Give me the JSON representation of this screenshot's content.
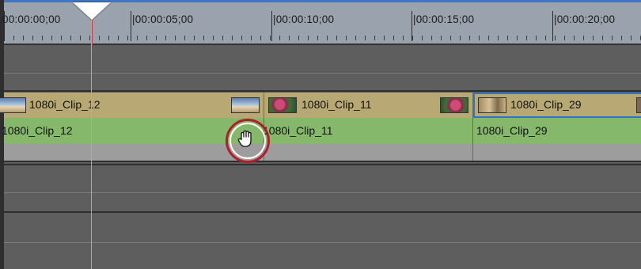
{
  "ruler": {
    "labels": [
      "00:00:00;00",
      "|00:00:05;00",
      "|00:00:10;00",
      "|00:00:15;00",
      "|00:00:20;00"
    ]
  },
  "clips": [
    {
      "name": "1080i_Clip_12",
      "title": "1080i_Clip_12",
      "audio_label": "1080i_Clip_12",
      "selected": false
    },
    {
      "name": "1080i_Clip_11",
      "title": "1080i_Clip_11",
      "audio_label": "1080i_Clip_11",
      "selected": false
    },
    {
      "name": "1080i_Clip_29",
      "title": "1080i_Clip_29",
      "audio_label": "1080i_Clip_29",
      "selected": true
    }
  ],
  "colors": {
    "ruler_bg": "#9aa3ad",
    "video_clip": "#b8a874",
    "audio_clip": "#86b86c",
    "selection": "#2f74c9",
    "playhead": "#4ad6d6",
    "cursor_ring": "#b01e2a"
  },
  "icons": {
    "playhead": "playhead-triangle-icon",
    "cursor": "hand-grab-cursor-icon"
  }
}
